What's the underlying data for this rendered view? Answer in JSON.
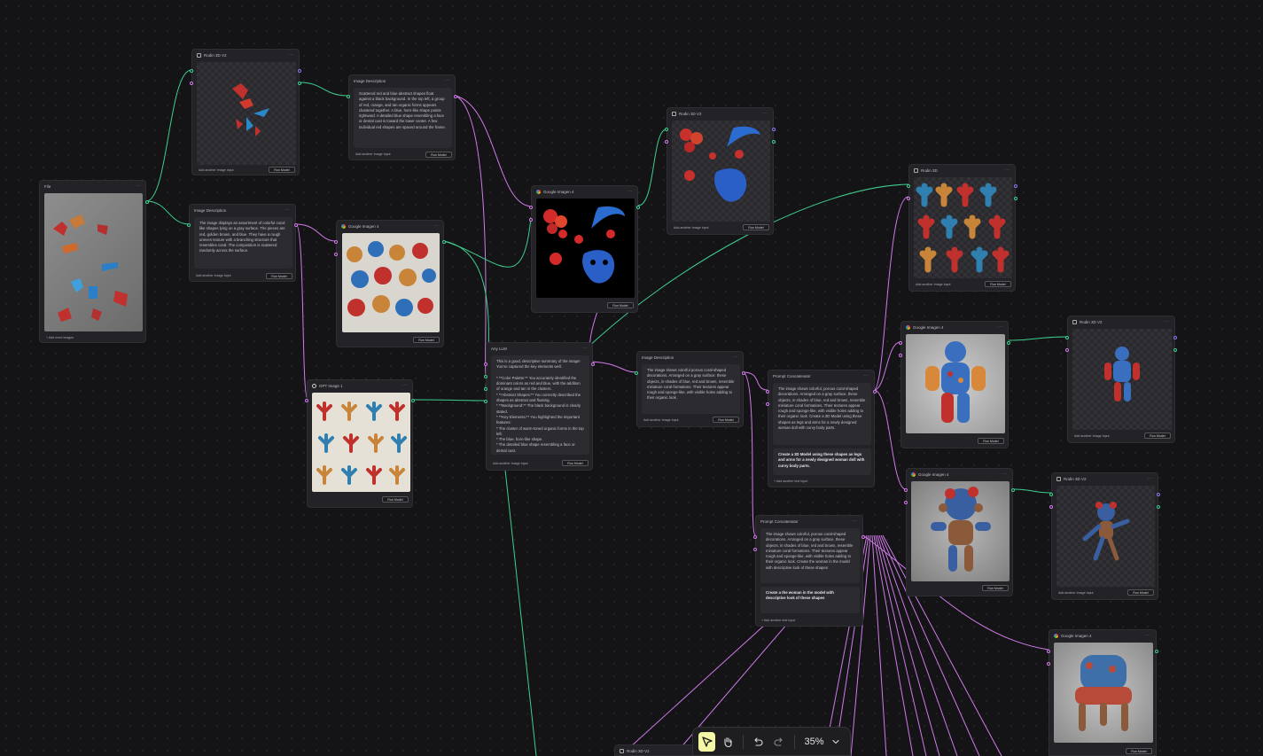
{
  "nodes": {
    "file": {
      "title": "File",
      "add_label": "+ Add more images"
    },
    "rodin_a": {
      "title": "Rodin 3D V2",
      "add_label": "Add another Image Input",
      "run_label": "Run Model"
    },
    "imgdesc_a": {
      "title": "Image Description",
      "text": "Scattered red and blue abstract shapes float against a black background. In the top left, a group of red, orange, and tan organic forms appears clustered together. A blue, horn-like shape points rightward. A detailed blue shape resembling a face or dental cast is toward the lower center. A few individual red shapes are spaced around the frame.",
      "add_label": "Add another Image Input",
      "run_label": "Run Model"
    },
    "imgdesc_b": {
      "title": "Image Description",
      "text": "The image displays an assortment of colorful coral-like shapes lying on a gray surface. The pieces are red, golden brown, and blue. They have a rough uneven texture with a branching structure that resembles coral. The composition is scattered randomly across the surface.",
      "add_label": "Add another Image Input",
      "run_label": "Run Model"
    },
    "google_a": {
      "title": "Google Imagen 4",
      "run_label": "Run Model"
    },
    "gpt_image": {
      "title": "GPT Image 1",
      "run_label": "Run Model"
    },
    "google_b": {
      "title": "Google Imagen 4",
      "run_label": "Run Model"
    },
    "rodin_b": {
      "title": "Rodin 3D V2",
      "add_label": "Add another Image Input",
      "run_label": "Run Model"
    },
    "any_llm": {
      "title": "Any LLM",
      "text": "This is a good, descriptive summary of the image! You've captured the key elements well.\n\n*  **Color Palette:** You accurately identified the dominant colors as red and blue, with the addition of orange and tan in the clusters.\n*  **Abstract Shapes:** You correctly described the shapes as abstract and floating.\n*  **Background:** The black background is clearly stated.\n*  **Key Elements:** You highlighted the important features:\n   *  The cluster of warm-toned organic forms in the top left.\n   *  The blue, horn-like shape.\n   *  The detailed blue shape resembling a face or dental cast.",
      "add_label": "Add another Image Input",
      "run_label": "Run Model"
    },
    "imgdesc_c": {
      "title": "Image Description",
      "text": "The image shows colorful porous coral-shaped decorations. Arranged on a gray surface: these objects, in shades of blue, red and brown, resemble miniature coral formations. Their textures appear rough and sponge-like, with visible holes adding to their organic look.",
      "add_label": "Add another Image Input",
      "run_label": "Run Model"
    },
    "rodin_c": {
      "title": "Rodin 3D",
      "add_label": "Add another Image Input",
      "run_label": "Run Model"
    },
    "prompt_a": {
      "title": "Prompt Concatenator",
      "text1": "The image shows colorful, porous coral-shaped decorations. Arranged on a gray surface, these objects, in shades of blue, red and brown, resemble miniature coral formations. Their textures appear rough and sponge-like, with visible holes adding to their organic look. Create a 3D Model using these shapes as legs and arms for a newly designed woman doll with curvy body parts.",
      "text2": "Create a 3D Model using these shapes as legs and arms for a newly designed woman doll with curvy body parts.",
      "add_label": "+ Add another text Input"
    },
    "prompt_b": {
      "title": "Prompt Concatenator",
      "text1": "The image shows colorful, porous coral-shaped decorations. Arranged on a gray surface, these objects, in shades of blue, red and brown, resemble miniature coral formations. Their textures appear rough and sponge-like, with visible holes adding to their organic look. Create the woman in the model with descriptive look of these shapes",
      "text2": "Create a the woman in the model with descriptive look of these shapes",
      "add_label": "+ Add another text Input"
    },
    "google_c": {
      "title": "Google Imagen 4",
      "run_label": "Run Model"
    },
    "google_d": {
      "title": "Google Imagen 4",
      "run_label": "Run Model"
    },
    "google_e": {
      "title": "Google Imagen 4",
      "run_label": "Run Model"
    },
    "rodin_d": {
      "title": "Rodin 3D V2",
      "add_label": "Add another Image Input",
      "run_label": "Run Model"
    },
    "rodin_e": {
      "title": "Rodin 3D V2",
      "add_label": "Add another Image Input",
      "run_label": "Run Model"
    },
    "rodin_f": {
      "title": "Rodin 3D V2"
    }
  },
  "toolbar": {
    "zoom": "35%"
  },
  "colors": {
    "wire_green": "#3ecf8e",
    "wire_pink": "#d07ae8",
    "accent": "#f4f7a6"
  }
}
